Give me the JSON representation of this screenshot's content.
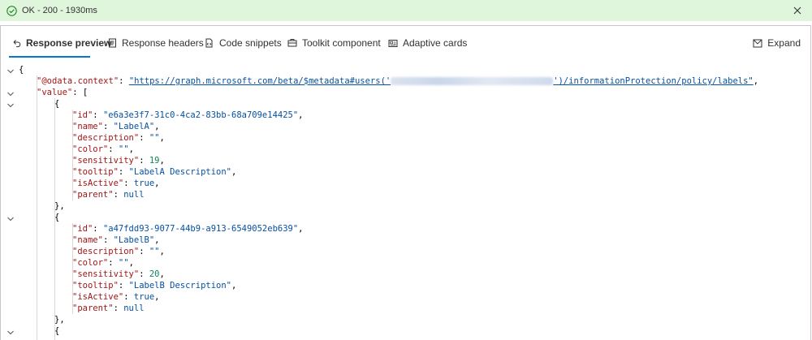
{
  "status": {
    "text": "OK - 200 - 1930ms",
    "color": "#dff6dd"
  },
  "tabs": [
    {
      "label": "Response preview",
      "icon": "redo-arrow-icon",
      "active": true
    },
    {
      "label": "Response headers",
      "icon": "document-icon",
      "active": false
    },
    {
      "label": "Code snippets",
      "icon": "code-snippet-icon",
      "active": false
    },
    {
      "label": "Toolkit component",
      "icon": "toolkit-icon",
      "active": false
    },
    {
      "label": "Adaptive cards",
      "icon": "card-icon",
      "active": false
    }
  ],
  "expand_label": "Expand",
  "json": {
    "open_brace": "{",
    "context_key": "\"@odata.context\"",
    "context_url_prefix": "\"https://graph.microsoft.com/beta/$metadata#users('",
    "context_url_suffix": "')/informationProtection/policy/labels\"",
    "value_key": "\"value\"",
    "label_a": {
      "id": "\"e6a3e3f7-31c0-4ca2-83bb-68a709e14425\"",
      "name": "\"LabelA\"",
      "description": "\"\"",
      "color": "\"\"",
      "sensitivity": "19",
      "tooltip": "\"LabelA Description\"",
      "isActive": "true",
      "parent": "null"
    },
    "label_b": {
      "id": "\"a47fdd93-9077-44b9-a913-6549052eb639\"",
      "name": "\"LabelB\"",
      "description": "\"\"",
      "color": "\"\"",
      "sensitivity": "20",
      "tooltip": "\"LabelB Description\"",
      "isActive": "true",
      "parent": "null"
    },
    "keys": {
      "id": "\"id\"",
      "name": "\"name\"",
      "description": "\"description\"",
      "color": "\"color\"",
      "sensitivity": "\"sensitivity\"",
      "tooltip": "\"tooltip\"",
      "isActive": "\"isActive\"",
      "parent": "\"parent\""
    }
  }
}
